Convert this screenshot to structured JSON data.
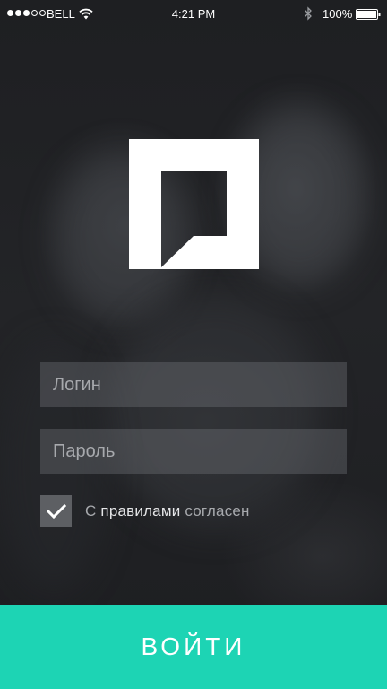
{
  "status_bar": {
    "carrier": "BELL",
    "time": "4:21 PM",
    "battery": "100%"
  },
  "logo": {
    "icon": "speech-bubble-logo"
  },
  "form": {
    "login_placeholder": "Логин",
    "password_placeholder": "Пароль",
    "agree_checked": true,
    "agree_prefix": "С",
    "agree_link": "правилами",
    "agree_suffix": "согласен"
  },
  "submit_label": "ВОЙТИ",
  "colors": {
    "accent": "#1dd4b4",
    "background": "#1e1f22"
  }
}
